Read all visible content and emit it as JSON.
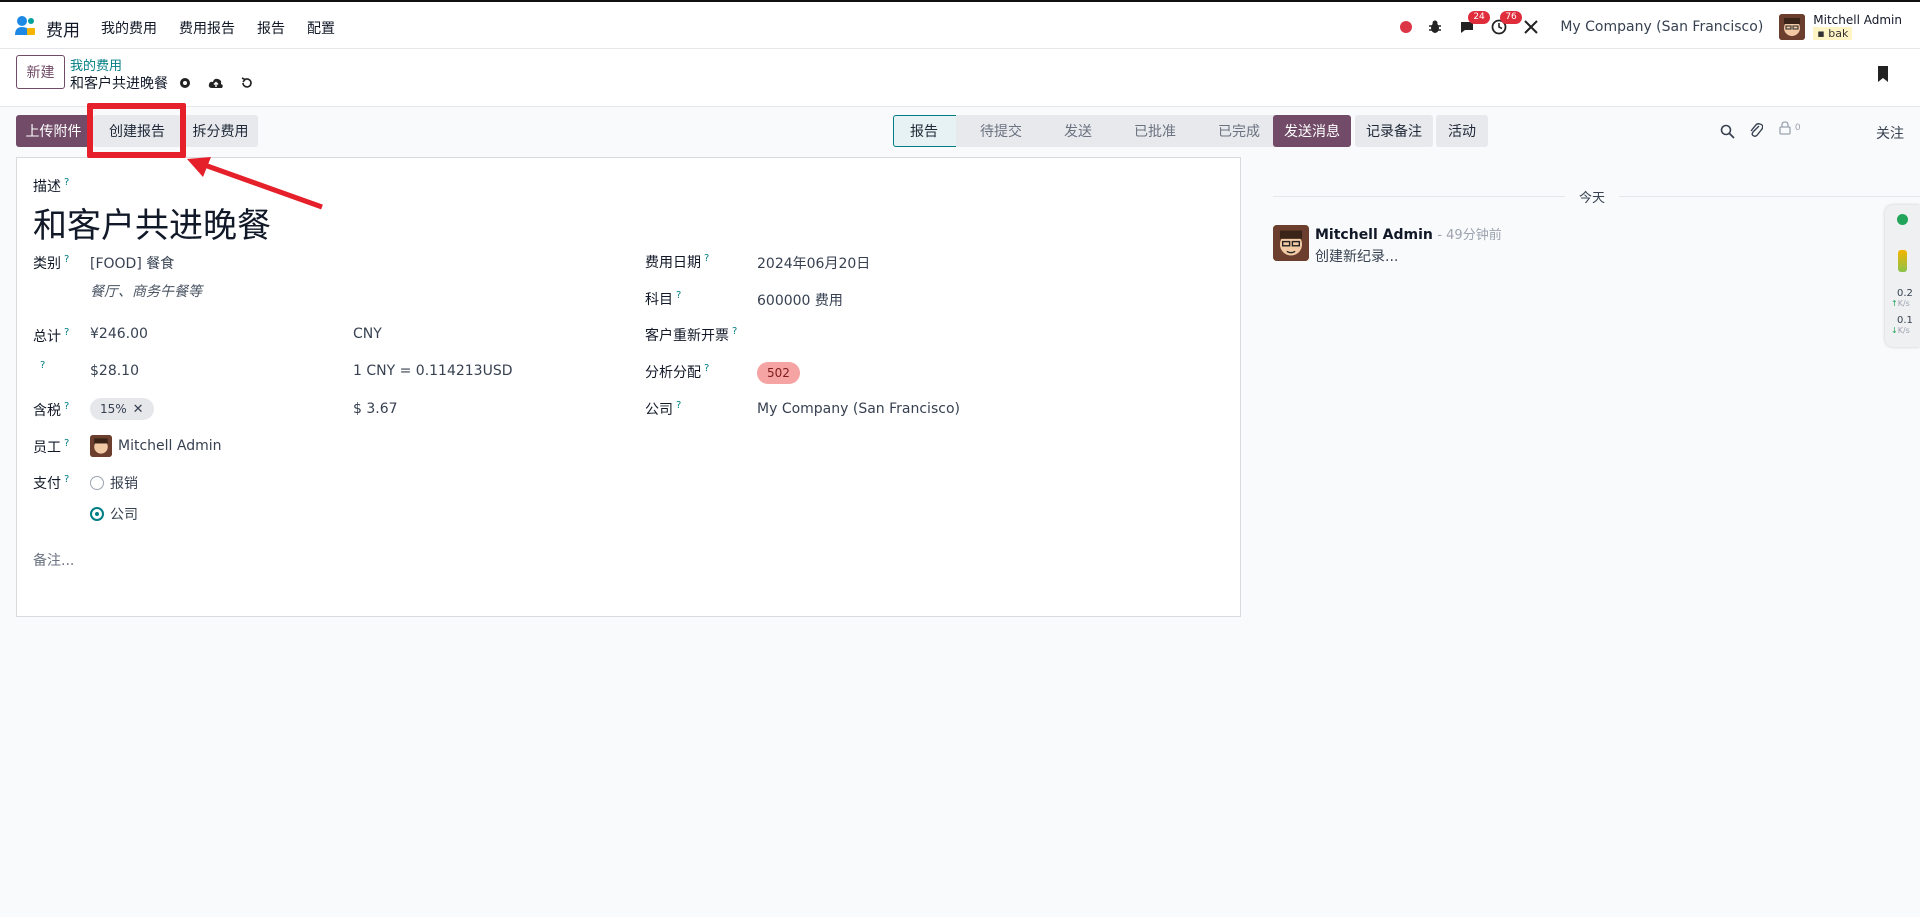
{
  "navbar": {
    "app_name": "费用",
    "menu": [
      "我的费用",
      "费用报告",
      "报告",
      "配置"
    ],
    "chat_badge": "24",
    "activity_badge": "76",
    "company": "My Company (San Francisco)",
    "user_name": "Mitchell Admin",
    "user_db": "bak"
  },
  "control": {
    "new_label": "新建",
    "breadcrumb": "我的费用",
    "record_name": "和客户共进晚餐"
  },
  "actions": {
    "upload": "上传附件",
    "create_report": "创建报告",
    "split": "拆分费用"
  },
  "status_stages": [
    "报告",
    "待提交",
    "发送",
    "已批准",
    "已完成"
  ],
  "form": {
    "desc_label": "描述",
    "desc_value": "和客户共进晚餐",
    "category_label": "类别",
    "category_value": "[FOOD] 餐食",
    "category_hint": "餐厅、商务午餐等",
    "total_label": "总计",
    "total_value": "¥246.00",
    "total_currency": "CNY",
    "converted_value": "$28.10",
    "rate": "1 CNY = 0.114213USD",
    "tax_label": "含税",
    "tax_tag": "15%",
    "tax_amount": "$ 3.67",
    "employee_label": "员工",
    "employee_value": "Mitchell Admin",
    "payment_label": "支付",
    "payment_options": [
      "报销",
      "公司"
    ],
    "payment_selected": "公司",
    "notes_placeholder": "备注...",
    "date_label": "费用日期",
    "date_value": "2024年06月20日",
    "account_label": "科目",
    "account_value": "600000 费用",
    "reinvoice_label": "客户重新开票",
    "analytic_label": "分析分配",
    "analytic_tag": "502",
    "company_label": "公司",
    "company_value": "My Company (San Francisco)"
  },
  "chatter": {
    "send_message": "发送消息",
    "log_note": "记录备注",
    "activity": "活动",
    "follower_count": "0",
    "follow": "关注",
    "today": "今天",
    "author": "Mitchell Admin",
    "time": "- 49分钟前",
    "body": "创建新纪录..."
  },
  "widget": {
    "up_value": "0.2",
    "up_unit": "K/s",
    "down_value": "0.1",
    "down_unit": "K/s"
  },
  "colors": {
    "brand": "#714b67",
    "teal": "#017e84",
    "highlight": "#e5202a"
  }
}
